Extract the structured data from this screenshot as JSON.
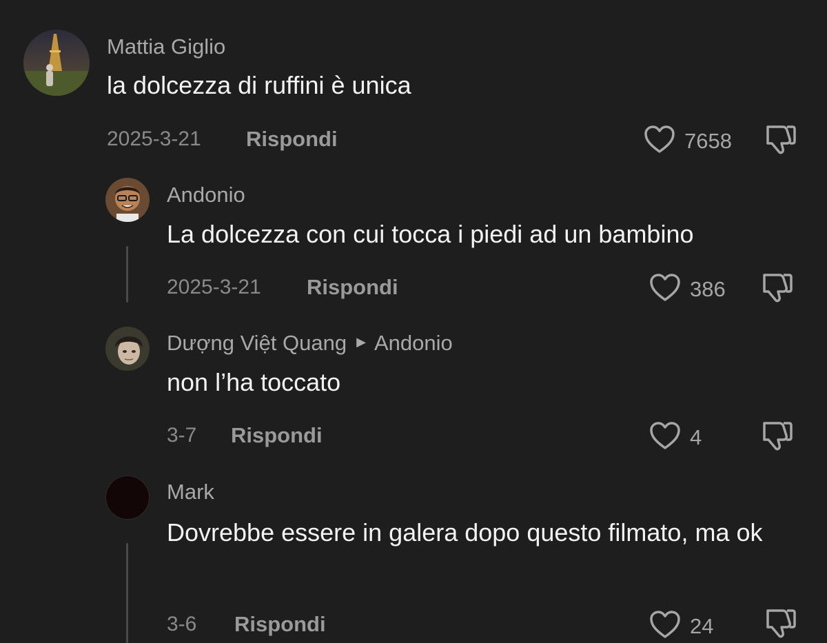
{
  "comments": [
    {
      "username": "Mattia Giglio",
      "text": "la dolcezza di ruffini è unica",
      "date": "2025-3-21",
      "reply_label": "Rispondi",
      "likes": "7658"
    },
    {
      "username": "Andonio",
      "text": "La dolcezza con cui tocca i piedi ad un bambino",
      "date": "2025-3-21",
      "reply_label": "Rispondi",
      "likes": "386"
    },
    {
      "username": "Dượng Việt Quang",
      "reply_to": "Andonio",
      "text": "non l’ha toccato",
      "date": "3-7",
      "reply_label": "Rispondi",
      "likes": "4"
    },
    {
      "username": "Mark",
      "text": "Dovrebbe essere in galera dopo questo filmato, ma ok",
      "date": "3-6",
      "reply_label": "Rispondi",
      "likes": "24"
    }
  ],
  "icons": {
    "like": "heart-outline-icon",
    "dislike": "thumbs-down-outline-icon",
    "reply_arrow": "triangle-right-icon"
  },
  "colors": {
    "background": "#1e1e1e",
    "username": "#a9a9a9",
    "text": "#f3f3f3",
    "meta": "#8a8a8a"
  }
}
